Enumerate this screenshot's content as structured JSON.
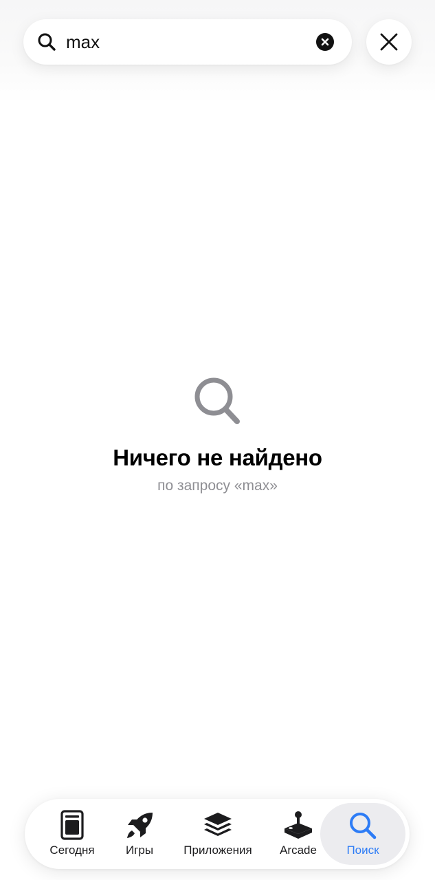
{
  "search": {
    "query": "max",
    "clear_icon": "xmark-circle-fill-icon",
    "close_icon": "xmark-icon"
  },
  "empty_state": {
    "icon": "magnifying-glass-icon",
    "title": "Ничего не найдено",
    "subtitle": "по запросу «max»"
  },
  "tab_bar": {
    "tabs": [
      {
        "label": "Сегодня",
        "icon": "today-icon",
        "active": false
      },
      {
        "label": "Игры",
        "icon": "rocket-icon",
        "active": false
      },
      {
        "label": "Приложения",
        "icon": "apps-stack-icon",
        "active": false
      },
      {
        "label": "Arcade",
        "icon": "joystick-icon",
        "active": false
      },
      {
        "label": "Поиск",
        "icon": "search-icon",
        "active": true
      }
    ]
  },
  "colors": {
    "accent": "#2d7cf6",
    "secondary_text": "#8e8e93",
    "active_tab_bg": "#ececef"
  }
}
